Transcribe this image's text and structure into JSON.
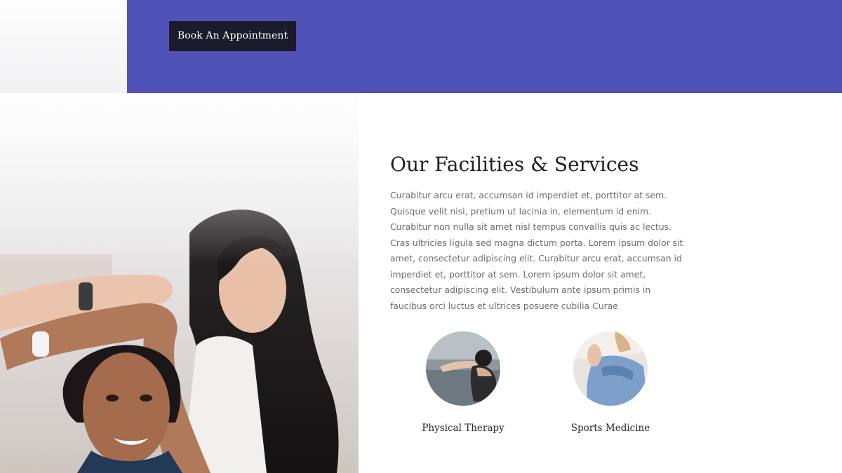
{
  "colors": {
    "banner": "#5052b8",
    "button_bg": "#1c1b2b",
    "heading": "#1f1f24",
    "body_text": "#6b6b72"
  },
  "banner": {
    "button_label": "Book An Appointment"
  },
  "hero_image": {
    "icon": "photo-trainer-stretching-client"
  },
  "section": {
    "title": "Our Facilities & Services",
    "body": "Curabitur arcu erat, accumsan id imperdiet et, porttitor at sem. Quisque velit nisi, pretium ut lacinia in, elementum id enim. Curabitur non nulla sit amet nisl tempus convallis quis ac lectus. Cras ultricies ligula sed magna dictum porta. Lorem ipsum dolor sit amet, consectetur adipiscing elit. Curabitur arcu erat, accumsan id imperdiet et, porttitor at sem. Lorem ipsum dolor sit amet, consectetur adipiscing elit. Vestibulum ante ipsum primis in faucibus orci luctus et ultrices posuere cubilia Curae"
  },
  "services": [
    {
      "label": "Physical Therapy",
      "icon": "physical-therapy-photo-icon"
    },
    {
      "label": "Sports Medicine",
      "icon": "sports-medicine-photo-icon"
    }
  ]
}
